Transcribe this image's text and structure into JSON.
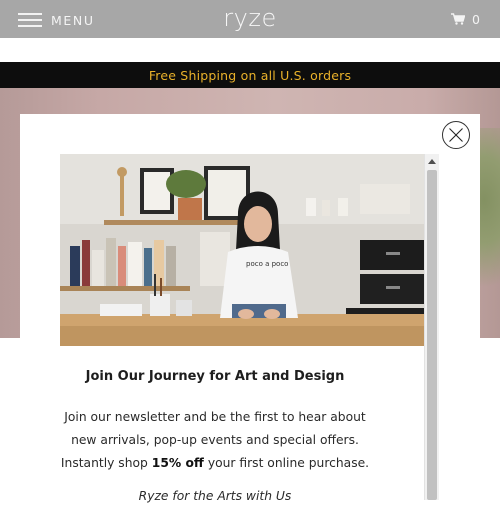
{
  "header": {
    "menu_label": "MENU",
    "logo_text": "ryze",
    "cart_count": "0",
    "bg_color": "#a7a7a7"
  },
  "announcement": {
    "text": "Free Shipping on all U.S. orders",
    "text_color": "#e9b12a",
    "bg_color": "#0d0d0d"
  },
  "popup": {
    "title": "Join Our Journey for Art and Design",
    "body_before": "Join our newsletter and be the first to hear about new arrivals, pop-up events and special offers.  Instantly shop",
    "body_highlight": "15% off",
    "body_after": "your first online purchase.",
    "tagline": "Ryze for the Arts with Us",
    "shirt_text": "poco a poco"
  },
  "icons": [
    "menu-icon",
    "cart-icon",
    "close-icon",
    "scroll-up-arrow-icon"
  ]
}
